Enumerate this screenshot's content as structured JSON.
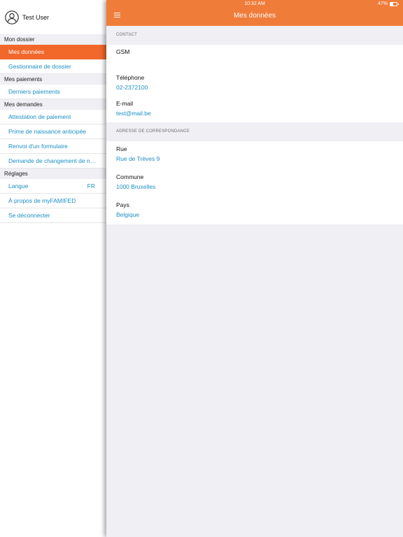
{
  "user": {
    "name": "Test User"
  },
  "sidebar": {
    "sections": [
      {
        "header": "Mon dossier",
        "items": [
          {
            "label": "Mes données",
            "active": true
          },
          {
            "label": "Gestionnaire de dossier"
          }
        ]
      },
      {
        "header": "Mes paiements",
        "items": [
          {
            "label": "Derniers paiements"
          }
        ]
      },
      {
        "header": "Mes demandes",
        "items": [
          {
            "label": "Attestation de paiement"
          },
          {
            "label": "Prime de naissance anticipée"
          },
          {
            "label": "Renvoi d'un formulaire"
          },
          {
            "label": "Demande de changement de nu..."
          }
        ]
      },
      {
        "header": "Réglages",
        "items": [
          {
            "label": "Langue",
            "value": "FR"
          },
          {
            "label": "À propos de myFAMIFED"
          },
          {
            "label": "Se déconnecter"
          }
        ]
      }
    ]
  },
  "status": {
    "time": "10:32 AM",
    "battery": "47%"
  },
  "navbar": {
    "title": "Mes données",
    "menu_icon": "hamburger-icon"
  },
  "contact": {
    "header": "CONTACT",
    "gsm_label": "GSM",
    "gsm_value": "",
    "phone_label": "Téléphone",
    "phone_value": "02-2372100",
    "email_label": "E-mail",
    "email_value": "test@mail.be"
  },
  "address": {
    "header": "ADRESSE DE CORRESPONDANCE",
    "street_label": "Rue",
    "street_value": "Rue de Trèves 9",
    "city_label": "Commune",
    "city_value": "1000 Bruxelles",
    "country_label": "Pays",
    "country_value": "Belgique"
  },
  "colors": {
    "accent": "#f2672a",
    "navbar": "#f07c3a",
    "link": "#1a8fc4",
    "section_bg": "#efeff4"
  }
}
